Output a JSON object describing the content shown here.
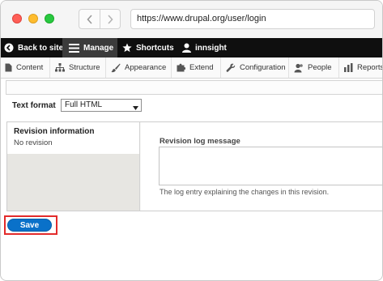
{
  "browser": {
    "url": "https://www.drupal.org/user/login"
  },
  "toolbar": {
    "back_to_site": "Back to site",
    "manage": "Manage",
    "shortcuts": "Shortcuts",
    "user": "innsight"
  },
  "tray": {
    "items": [
      {
        "label": "Content",
        "icon": "file-icon"
      },
      {
        "label": "Structure",
        "icon": "sitemap-icon"
      },
      {
        "label": "Appearance",
        "icon": "paintbrush-icon"
      },
      {
        "label": "Extend",
        "icon": "puzzle-icon"
      },
      {
        "label": "Configuration",
        "icon": "wrench-icon"
      },
      {
        "label": "People",
        "icon": "people-icon"
      },
      {
        "label": "Reports",
        "icon": "bar-chart-icon"
      }
    ]
  },
  "text_format": {
    "label": "Text format",
    "selected": "Full HTML"
  },
  "revision": {
    "title": "Revision information",
    "summary": "No revision",
    "log_label": "Revision log message",
    "log_value": "",
    "log_help": "The log entry explaining the changes in this revision."
  },
  "actions": {
    "save": "Save",
    "highlight_color": "#e32b2b",
    "save_color": "#0a71c9"
  }
}
